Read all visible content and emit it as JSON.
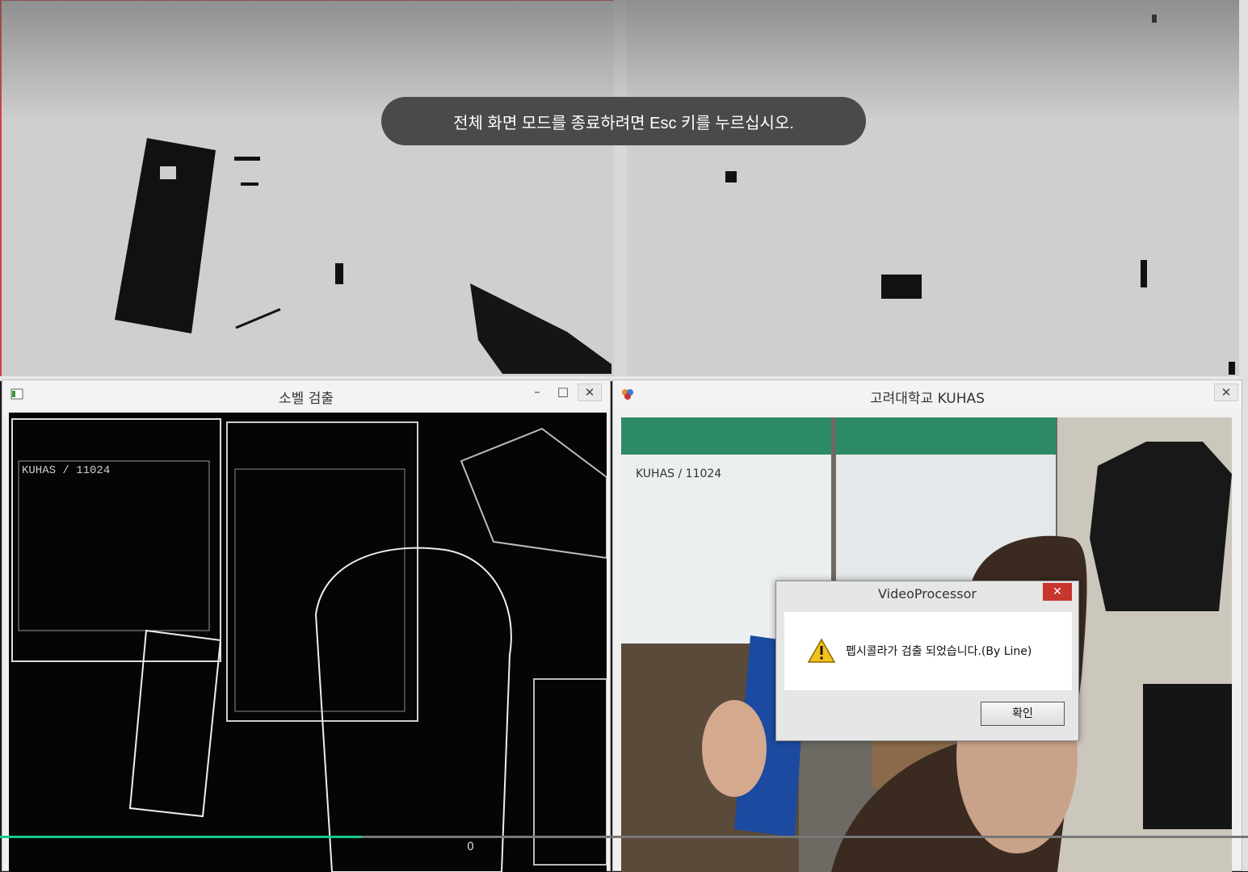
{
  "fullscreen_notice": "전체 화면 모드를 종료하려면 Esc 키를 누르십시오.",
  "windows": {
    "sobel": {
      "title": "소벨 검출",
      "minimize": "–",
      "maximize": "□",
      "close": "✕",
      "poster_text": "KUHAS / 11024"
    },
    "camera": {
      "title": "고려대학교 KUHAS",
      "close": "✕",
      "poster_text": "KUHAS / 11024"
    }
  },
  "dialog": {
    "title": "VideoProcessor",
    "close": "✕",
    "icon": "warning-icon",
    "message": "펩시콜라가 검출 되었습니다.(By Line)",
    "ok_label": "확인"
  },
  "player": {
    "progress": 0.29,
    "position_label": "0"
  },
  "colors": {
    "seek_fill": "#19c98a",
    "close_red": "#c7352d",
    "binary_bg": "#cfcfcf"
  }
}
